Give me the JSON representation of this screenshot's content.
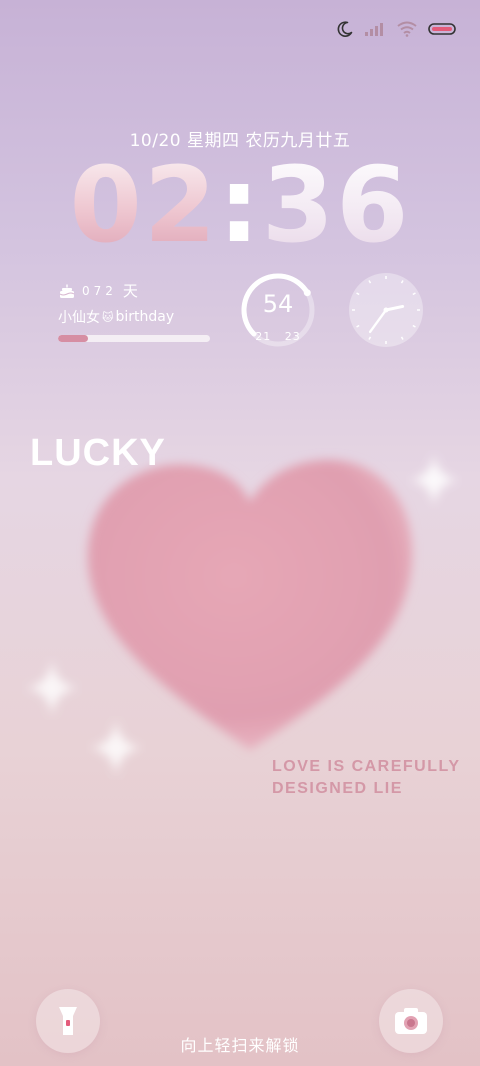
{
  "status_bar": {
    "icons": [
      "moon-icon",
      "signal-icon",
      "wifi-icon",
      "battery-icon"
    ]
  },
  "date_line": "10/20 星期四 农历九月廿五",
  "clock": {
    "h1": "0",
    "h2": "2",
    "colon": ":",
    "m1": "3",
    "m2": "6"
  },
  "countdown": {
    "icon": "cake-icon",
    "days": "072",
    "unit": "天",
    "label_prefix": "小仙女",
    "label_emoji": "🐱",
    "label_suffix": "birthday",
    "progress": 0.2,
    "colors": {
      "fill": "#d68ea3",
      "track": "#f4eef4"
    }
  },
  "weather": {
    "current": "54",
    "low": "21",
    "high": "23",
    "ring_fraction": 0.72
  },
  "analog_clock": {
    "hour": 2,
    "minute": 36
  },
  "lucky_text": "LUCKY",
  "tagline": [
    "LOVE IS CAREFULLY",
    "DESIGNED LIE"
  ],
  "bottom": {
    "left_icon": "flashlight-icon",
    "right_icon": "camera-icon",
    "unlock_hint": "向上轻扫来解锁"
  },
  "colors": {
    "accent_pink": "#d498a7",
    "heart": "#e0a2b0"
  }
}
